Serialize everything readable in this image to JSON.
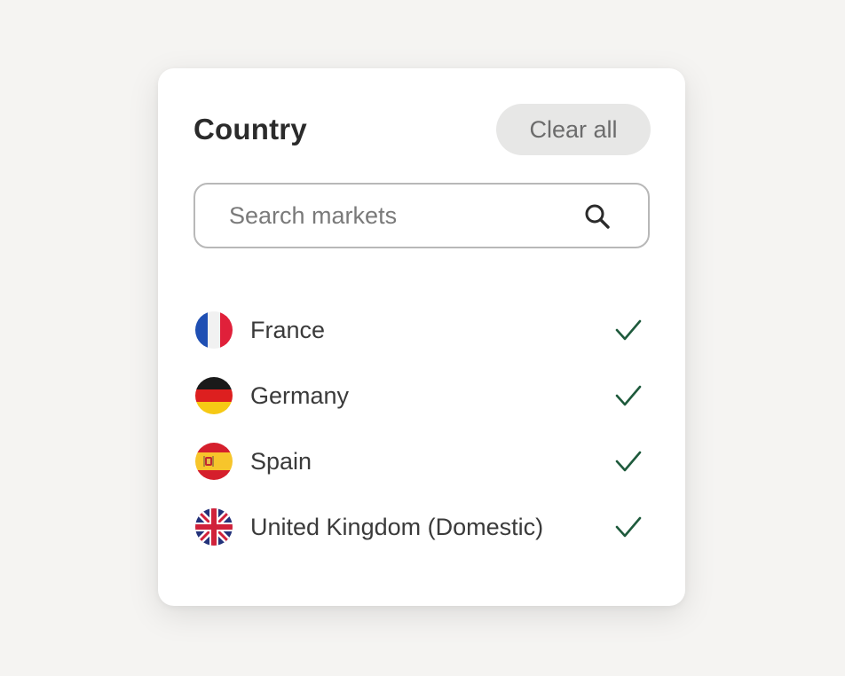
{
  "panel": {
    "title": "Country",
    "clear_label": "Clear all"
  },
  "search": {
    "placeholder": "Search markets",
    "value": ""
  },
  "countries": [
    {
      "name": "France",
      "flag": "flag-france-icon",
      "selected": true
    },
    {
      "name": "Germany",
      "flag": "flag-germany-icon",
      "selected": true
    },
    {
      "name": "Spain",
      "flag": "flag-spain-icon",
      "selected": true
    },
    {
      "name": "United Kingdom (Domestic)",
      "flag": "flag-uk-icon",
      "selected": true
    }
  ],
  "colors": {
    "background": "#f5f4f2",
    "card": "#ffffff",
    "check": "#1e5a3c",
    "clear_button_bg": "#e7e7e6"
  }
}
